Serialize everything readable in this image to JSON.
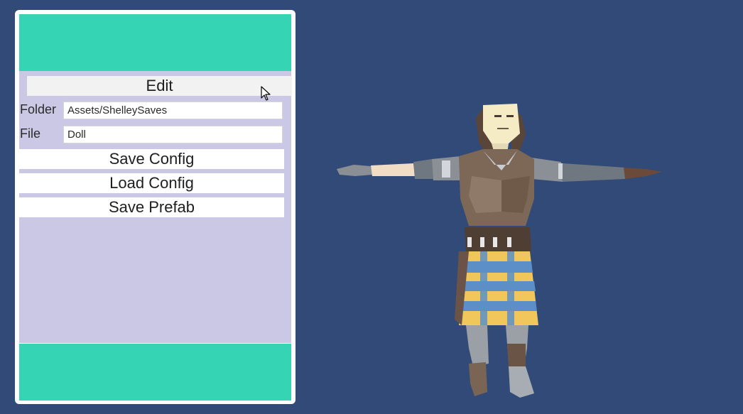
{
  "panel": {
    "edit_button": "Edit",
    "folder_label": "Folder",
    "folder_value": "Assets/ShelleySaves",
    "file_label": "File",
    "file_value": "Doll",
    "save_config_button": "Save Config",
    "load_config_button": "Load Config",
    "save_prefab_button": "Save Prefab"
  },
  "icons": {
    "cursor": "mouse-pointer-icon"
  },
  "colors": {
    "background": "#314a77",
    "band": "#35d4b4",
    "panel_body": "#cbc8e6"
  }
}
